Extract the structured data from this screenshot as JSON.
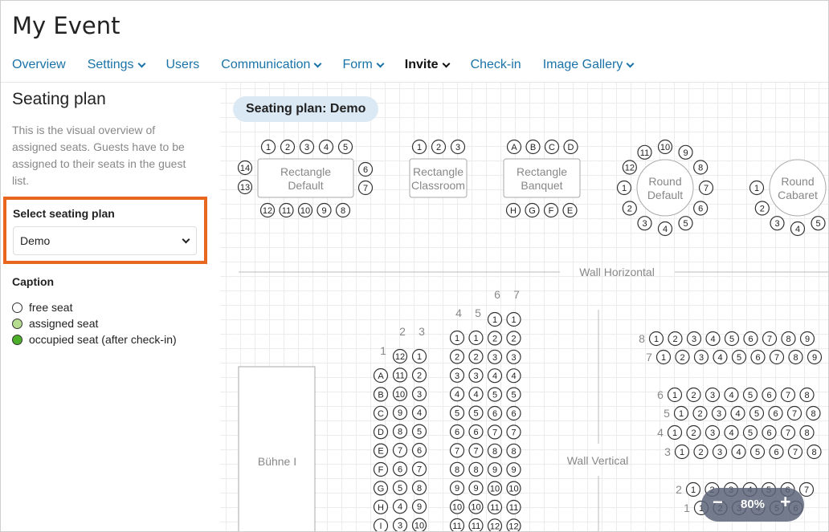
{
  "app_title": "My Event",
  "nav": [
    {
      "label": "Overview",
      "dropdown": false,
      "active": false
    },
    {
      "label": "Settings",
      "dropdown": true,
      "active": false
    },
    {
      "label": "Users",
      "dropdown": false,
      "active": false
    },
    {
      "label": "Communication",
      "dropdown": true,
      "active": false
    },
    {
      "label": "Form",
      "dropdown": true,
      "active": false
    },
    {
      "label": "Invite",
      "dropdown": true,
      "active": true
    },
    {
      "label": "Check-in",
      "dropdown": false,
      "active": false
    },
    {
      "label": "Image Gallery",
      "dropdown": true,
      "active": false
    }
  ],
  "sidebar": {
    "title": "Seating plan",
    "description": "This is the visual overview of assigned seats. Guests have to be assigned to their seats in the guest list.",
    "select_label": "Select seating plan",
    "select_value": "Demo",
    "caption_title": "Caption",
    "caption_items": [
      {
        "label": "free seat",
        "color": "#ffffff"
      },
      {
        "label": "assigned seat",
        "color": "#b5dc8f"
      },
      {
        "label": "occupied seat (after check-in)",
        "color": "#4caf2a"
      }
    ]
  },
  "plan": {
    "title": "Seating plan: Demo",
    "tables": [
      {
        "label": [
          "Rectangle",
          "Default"
        ],
        "seats_top": [
          "1",
          "2",
          "3",
          "4",
          "5"
        ],
        "seats_right": [
          "6",
          "7"
        ],
        "seats_bottom": [
          "12",
          "11",
          "10",
          "9",
          "8"
        ],
        "seats_left": [
          "14",
          "13"
        ]
      },
      {
        "label": [
          "Rectangle",
          "Classroom"
        ],
        "seats_top": [
          "1",
          "2",
          "3"
        ]
      },
      {
        "label": [
          "Rectangle",
          "Banquet"
        ],
        "seats_top": [
          "A",
          "B",
          "C",
          "D"
        ],
        "seats_bottom": [
          "H",
          "G",
          "F",
          "E"
        ]
      },
      {
        "label": [
          "Round",
          "Default"
        ],
        "seats": [
          "1",
          "2",
          "3",
          "4",
          "5",
          "6",
          "7",
          "8",
          "9",
          "10",
          "11",
          "12"
        ]
      },
      {
        "label": [
          "Round",
          "Cabaret"
        ],
        "seats": [
          "1",
          "2",
          "3",
          "4",
          "5"
        ]
      }
    ],
    "wall_horizontal": "Wall Horizontal",
    "wall_vertical": "Wall Vertical",
    "stage": "Bühne I",
    "block_a": {
      "col_headers": [
        "1",
        "2",
        "3"
      ],
      "row_letters": [
        "A",
        "B",
        "C",
        "D",
        "E",
        "F",
        "G",
        "H",
        "I"
      ],
      "col2": [
        "12",
        "11",
        "10",
        "9",
        "8",
        "7",
        "6",
        "5",
        "4",
        "3"
      ],
      "col3": [
        "1",
        "2",
        "3",
        "4",
        "5",
        "6",
        "7",
        "8",
        "9",
        "10"
      ]
    },
    "block_b": {
      "col_headers": [
        "4",
        "5",
        "6",
        "7"
      ],
      "columns": [
        [
          "1",
          "2",
          "3",
          "4",
          "5",
          "6",
          "7",
          "8",
          "9",
          "10",
          "11"
        ],
        [
          "1",
          "2",
          "3",
          "4",
          "5",
          "6",
          "7",
          "8",
          "9",
          "10",
          "11"
        ],
        [
          "1",
          "2",
          "3",
          "4",
          "5",
          "6",
          "7",
          "8",
          "9",
          "10",
          "11",
          "12"
        ],
        [
          "1",
          "2",
          "3",
          "4",
          "5",
          "6",
          "7",
          "8",
          "9",
          "10",
          "11",
          "12"
        ]
      ]
    },
    "block_c": {
      "rows": [
        {
          "label": "8",
          "seats": [
            "1",
            "2",
            "3",
            "4",
            "5",
            "6",
            "7",
            "8",
            "9"
          ]
        },
        {
          "label": "7",
          "seats": [
            "1",
            "2",
            "3",
            "4",
            "5",
            "6",
            "7",
            "8",
            "9"
          ]
        },
        {
          "label": "6",
          "seats": [
            "1",
            "2",
            "3",
            "4",
            "5",
            "6",
            "7",
            "8"
          ]
        },
        {
          "label": "5",
          "seats": [
            "1",
            "2",
            "3",
            "4",
            "5",
            "6",
            "7",
            "8"
          ]
        },
        {
          "label": "4",
          "seats": [
            "1",
            "2",
            "3",
            "4",
            "5",
            "6",
            "7",
            "8"
          ]
        },
        {
          "label": "3",
          "seats": [
            "1",
            "2",
            "3",
            "4",
            "5",
            "6",
            "7",
            "8"
          ]
        },
        {
          "label": "2",
          "seats": [
            "1",
            "2",
            "3",
            "4",
            "5",
            "6",
            "7"
          ]
        },
        {
          "label": "1",
          "seats": [
            "1",
            "2",
            "3",
            "4",
            "5",
            "6"
          ]
        }
      ]
    }
  },
  "zoom": {
    "minus": "−",
    "value": "80%",
    "plus": "+"
  }
}
